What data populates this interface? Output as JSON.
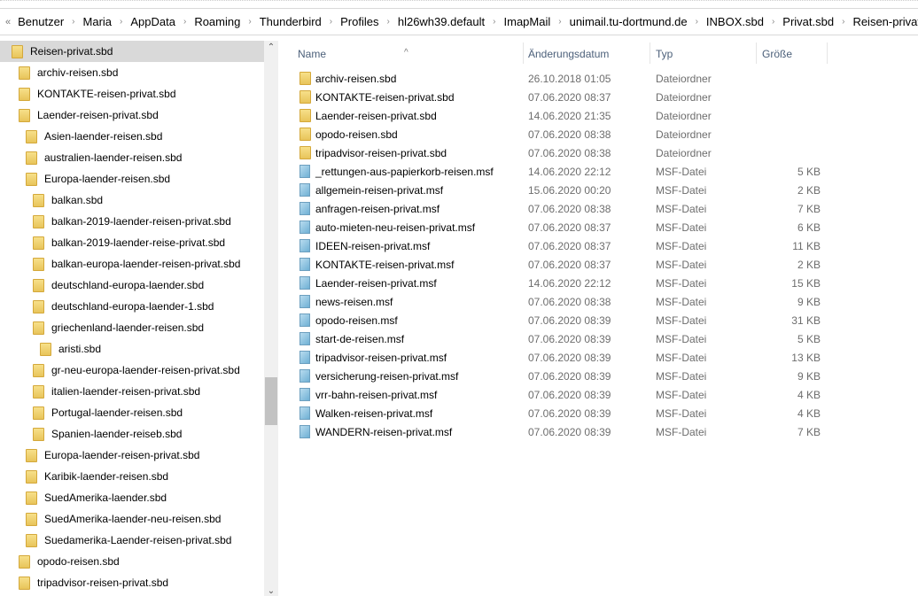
{
  "breadcrumb": [
    "Benutzer",
    "Maria",
    "AppData",
    "Roaming",
    "Thunderbird",
    "Profiles",
    "hl26wh39.default",
    "ImapMail",
    "unimail.tu-dortmund.de",
    "INBOX.sbd",
    "Privat.sbd",
    "Reisen-privat.sbd"
  ],
  "tree": [
    {
      "label": "Reisen-privat.sbd",
      "level": 0,
      "selected": true
    },
    {
      "label": "archiv-reisen.sbd",
      "level": 1
    },
    {
      "label": "KONTAKTE-reisen-privat.sbd",
      "level": 1
    },
    {
      "label": "Laender-reisen-privat.sbd",
      "level": 1
    },
    {
      "label": "Asien-laender-reisen.sbd",
      "level": 2
    },
    {
      "label": "australien-laender-reisen.sbd",
      "level": 2
    },
    {
      "label": "Europa-laender-reisen.sbd",
      "level": 2
    },
    {
      "label": "balkan.sbd",
      "level": 3
    },
    {
      "label": "balkan-2019-laender-reisen-privat.sbd",
      "level": 3
    },
    {
      "label": "balkan-2019-laender-reise-privat.sbd",
      "level": 3
    },
    {
      "label": "balkan-europa-laender-reisen-privat.sbd",
      "level": 3
    },
    {
      "label": "deutschland-europa-laender.sbd",
      "level": 3
    },
    {
      "label": "deutschland-europa-laender-1.sbd",
      "level": 3
    },
    {
      "label": "griechenland-laender-reisen.sbd",
      "level": 3
    },
    {
      "label": "aristi.sbd",
      "level": 4
    },
    {
      "label": "gr-neu-europa-laender-reisen-privat.sbd",
      "level": 3
    },
    {
      "label": "italien-laender-reisen-privat.sbd",
      "level": 3
    },
    {
      "label": "Portugal-laender-reisen.sbd",
      "level": 3
    },
    {
      "label": "Spanien-laender-reiseb.sbd",
      "level": 3
    },
    {
      "label": "Europa-laender-reisen-privat.sbd",
      "level": 2
    },
    {
      "label": "Karibik-laender-reisen.sbd",
      "level": 2
    },
    {
      "label": "SuedAmerika-laender.sbd",
      "level": 2
    },
    {
      "label": "SuedAmerika-laender-neu-reisen.sbd",
      "level": 2
    },
    {
      "label": "Suedamerika-Laender-reisen-privat.sbd",
      "level": 2
    },
    {
      "label": "opodo-reisen.sbd",
      "level": 1
    },
    {
      "label": "tripadvisor-reisen-privat.sbd",
      "level": 1
    }
  ],
  "columns": {
    "name": "Name",
    "date": "Änderungsdatum",
    "type": "Typ",
    "size": "Größe"
  },
  "files": [
    {
      "name": "archiv-reisen.sbd",
      "date": "26.10.2018 01:05",
      "type": "Dateiordner",
      "size": "",
      "icon": "folder"
    },
    {
      "name": "KONTAKTE-reisen-privat.sbd",
      "date": "07.06.2020 08:37",
      "type": "Dateiordner",
      "size": "",
      "icon": "folder"
    },
    {
      "name": "Laender-reisen-privat.sbd",
      "date": "14.06.2020 21:35",
      "type": "Dateiordner",
      "size": "",
      "icon": "folder"
    },
    {
      "name": "opodo-reisen.sbd",
      "date": "07.06.2020 08:38",
      "type": "Dateiordner",
      "size": "",
      "icon": "folder"
    },
    {
      "name": "tripadvisor-reisen-privat.sbd",
      "date": "07.06.2020 08:38",
      "type": "Dateiordner",
      "size": "",
      "icon": "folder"
    },
    {
      "name": "_rettungen-aus-papierkorb-reisen.msf",
      "date": "14.06.2020 22:12",
      "type": "MSF-Datei",
      "size": "5 KB",
      "icon": "file"
    },
    {
      "name": "allgemein-reisen-privat.msf",
      "date": "15.06.2020 00:20",
      "type": "MSF-Datei",
      "size": "2 KB",
      "icon": "file"
    },
    {
      "name": "anfragen-reisen-privat.msf",
      "date": "07.06.2020 08:38",
      "type": "MSF-Datei",
      "size": "7 KB",
      "icon": "file"
    },
    {
      "name": "auto-mieten-neu-reisen-privat.msf",
      "date": "07.06.2020 08:37",
      "type": "MSF-Datei",
      "size": "6 KB",
      "icon": "file"
    },
    {
      "name": "IDEEN-reisen-privat.msf",
      "date": "07.06.2020 08:37",
      "type": "MSF-Datei",
      "size": "11 KB",
      "icon": "file"
    },
    {
      "name": "KONTAKTE-reisen-privat.msf",
      "date": "07.06.2020 08:37",
      "type": "MSF-Datei",
      "size": "2 KB",
      "icon": "file"
    },
    {
      "name": "Laender-reisen-privat.msf",
      "date": "14.06.2020 22:12",
      "type": "MSF-Datei",
      "size": "15 KB",
      "icon": "file"
    },
    {
      "name": "news-reisen.msf",
      "date": "07.06.2020 08:38",
      "type": "MSF-Datei",
      "size": "9 KB",
      "icon": "file"
    },
    {
      "name": "opodo-reisen.msf",
      "date": "07.06.2020 08:39",
      "type": "MSF-Datei",
      "size": "31 KB",
      "icon": "file"
    },
    {
      "name": "start-de-reisen.msf",
      "date": "07.06.2020 08:39",
      "type": "MSF-Datei",
      "size": "5 KB",
      "icon": "file"
    },
    {
      "name": "tripadvisor-reisen-privat.msf",
      "date": "07.06.2020 08:39",
      "type": "MSF-Datei",
      "size": "13 KB",
      "icon": "file"
    },
    {
      "name": "versicherung-reisen-privat.msf",
      "date": "07.06.2020 08:39",
      "type": "MSF-Datei",
      "size": "9 KB",
      "icon": "file"
    },
    {
      "name": "vrr-bahn-reisen-privat.msf",
      "date": "07.06.2020 08:39",
      "type": "MSF-Datei",
      "size": "4 KB",
      "icon": "file"
    },
    {
      "name": "Walken-reisen-privat.msf",
      "date": "07.06.2020 08:39",
      "type": "MSF-Datei",
      "size": "4 KB",
      "icon": "file"
    },
    {
      "name": "WANDERN-reisen-privat.msf",
      "date": "07.06.2020 08:39",
      "type": "MSF-Datei",
      "size": "7 KB",
      "icon": "file"
    }
  ]
}
